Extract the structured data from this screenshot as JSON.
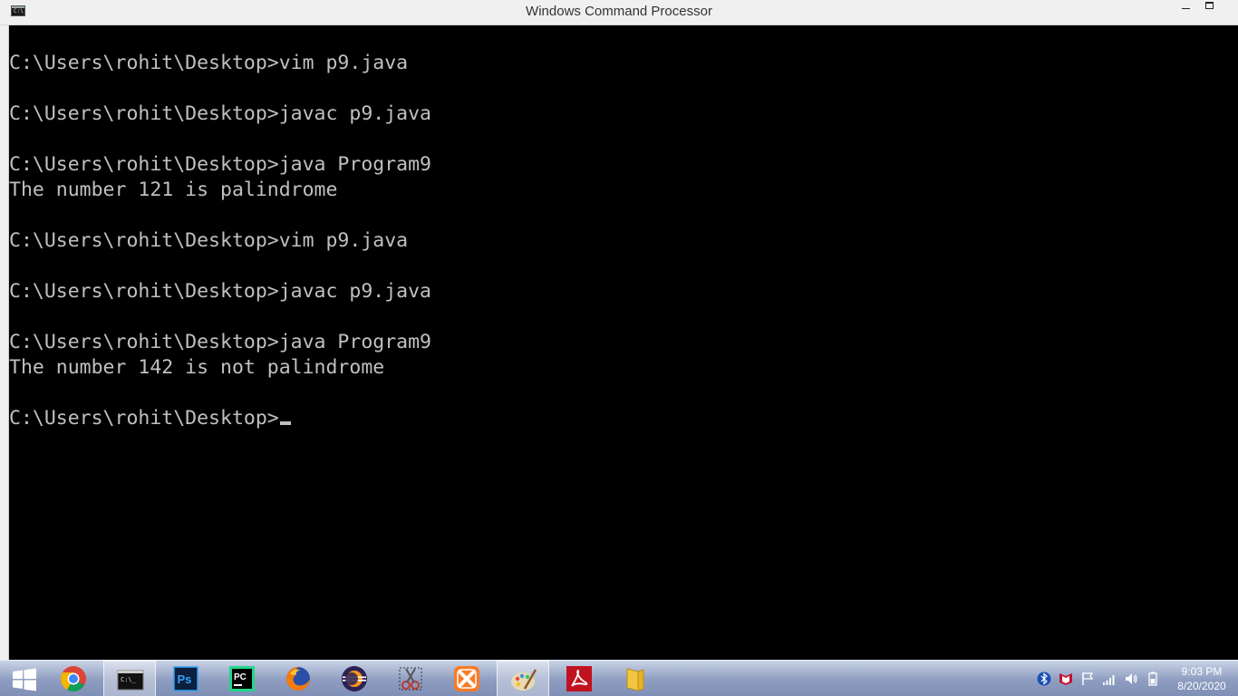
{
  "window": {
    "title": "Windows Command Processor",
    "icon_glyph": "C:\\",
    "icon_name": "cmd-icon"
  },
  "console": {
    "lines": [
      "C:\\Users\\rohit\\Desktop>vim p9.java",
      "",
      "C:\\Users\\rohit\\Desktop>javac p9.java",
      "",
      "C:\\Users\\rohit\\Desktop>java Program9",
      "The number 121 is palindrome",
      "",
      "C:\\Users\\rohit\\Desktop>vim p9.java",
      "",
      "C:\\Users\\rohit\\Desktop>javac p9.java",
      "",
      "C:\\Users\\rohit\\Desktop>java Program9",
      "The number 142 is not palindrome",
      "",
      "C:\\Users\\rohit\\Desktop>"
    ],
    "text_color": "#c0c0c0",
    "background": "#000000"
  },
  "taskbar": {
    "pinned": [
      {
        "name": "chrome-icon",
        "active": false
      },
      {
        "name": "cmd-icon",
        "active": true
      },
      {
        "name": "photoshop-icon",
        "active": false,
        "label": "Ps"
      },
      {
        "name": "pycharm-icon",
        "active": false,
        "label": "PC"
      },
      {
        "name": "firefox-icon",
        "active": false
      },
      {
        "name": "eclipse-icon",
        "active": false
      },
      {
        "name": "snipping-tool-icon",
        "active": false
      },
      {
        "name": "xampp-icon",
        "active": false
      },
      {
        "name": "paint-icon",
        "active": false
      },
      {
        "name": "acrobat-icon",
        "active": false
      },
      {
        "name": "file-explorer-icon",
        "active": false
      }
    ],
    "tray": [
      "bluetooth-icon",
      "mcafee-icon",
      "action-center-flag-icon",
      "network-signal-icon",
      "volume-icon",
      "battery-icon"
    ]
  },
  "clock": {
    "time": "9:03 PM",
    "date": "8/20/2020"
  }
}
